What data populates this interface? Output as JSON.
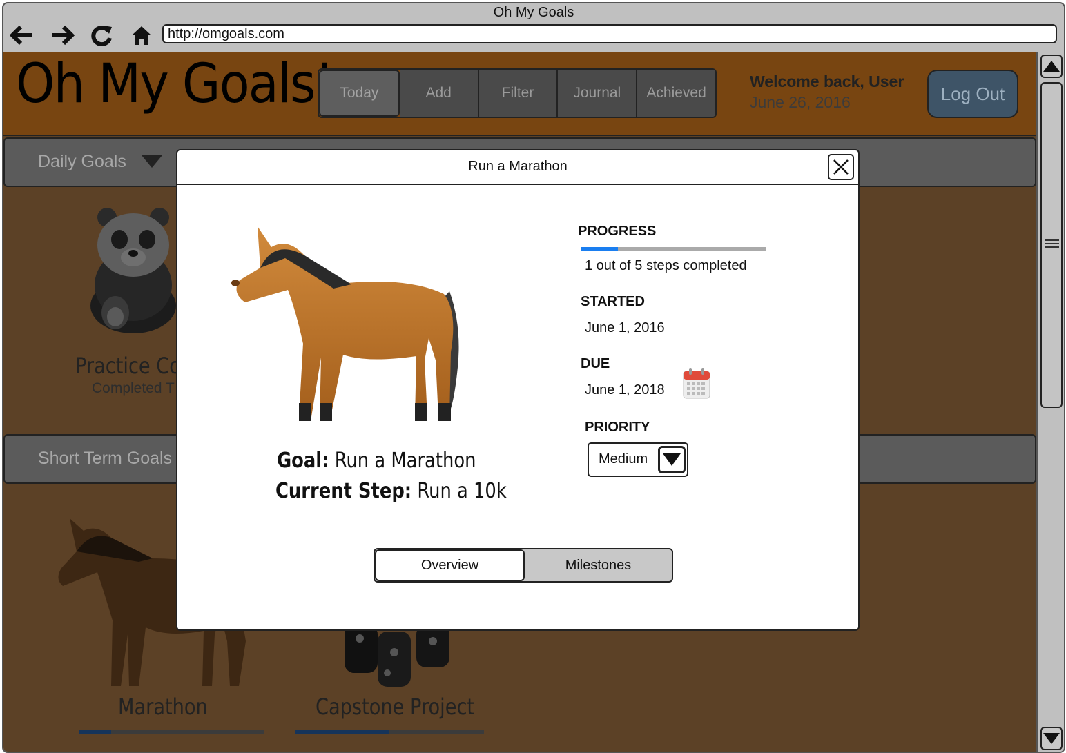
{
  "browser": {
    "title": "Oh My Goals",
    "url": "http://omgoals.com",
    "nav_icons": [
      "back-arrow-icon",
      "forward-arrow-icon",
      "reload-icon",
      "home-icon"
    ]
  },
  "header": {
    "logo": "Oh My Goals!",
    "tabs": [
      {
        "label": "Today",
        "active": true
      },
      {
        "label": "Add"
      },
      {
        "label": "Filter"
      },
      {
        "label": "Journal"
      },
      {
        "label": "Achieved"
      }
    ],
    "welcome": "Welcome back, User",
    "date": "June 26, 2016",
    "logout_label": "Log Out"
  },
  "sections": {
    "daily": {
      "label": "Daily Goals",
      "cards": [
        {
          "title": "Practice Co",
          "subtitle": "Completed T",
          "image": "panda"
        }
      ]
    },
    "short_term": {
      "label": "Short Term Goals",
      "cards": [
        {
          "title": "Marathon",
          "progress": 0.17,
          "image": "horse"
        },
        {
          "title": "Capstone Project",
          "progress": 0.5,
          "image": "boots"
        }
      ]
    }
  },
  "modal": {
    "title": "Run a Marathon",
    "progress_label": "PROGRESS",
    "progress_fraction": 0.2,
    "progress_text": "1 out of 5 steps completed",
    "started_label": "STARTED",
    "started_value": "June 1, 2016",
    "due_label": "DUE",
    "due_value": "June 1, 2018",
    "priority_label": "PRIORITY",
    "priority_value": "Medium",
    "goal_label": "Goal:",
    "goal_value": "Run a Marathon",
    "step_label": "Current Step:",
    "step_value": "Run a 10k",
    "tabs": [
      {
        "label": "Overview",
        "active": true
      },
      {
        "label": "Milestones"
      }
    ]
  },
  "colors": {
    "header_bg": "#784511",
    "page_bg": "#5c4126",
    "progress_fill": "#1a7ef0",
    "calendar_red": "#e04a3a"
  }
}
